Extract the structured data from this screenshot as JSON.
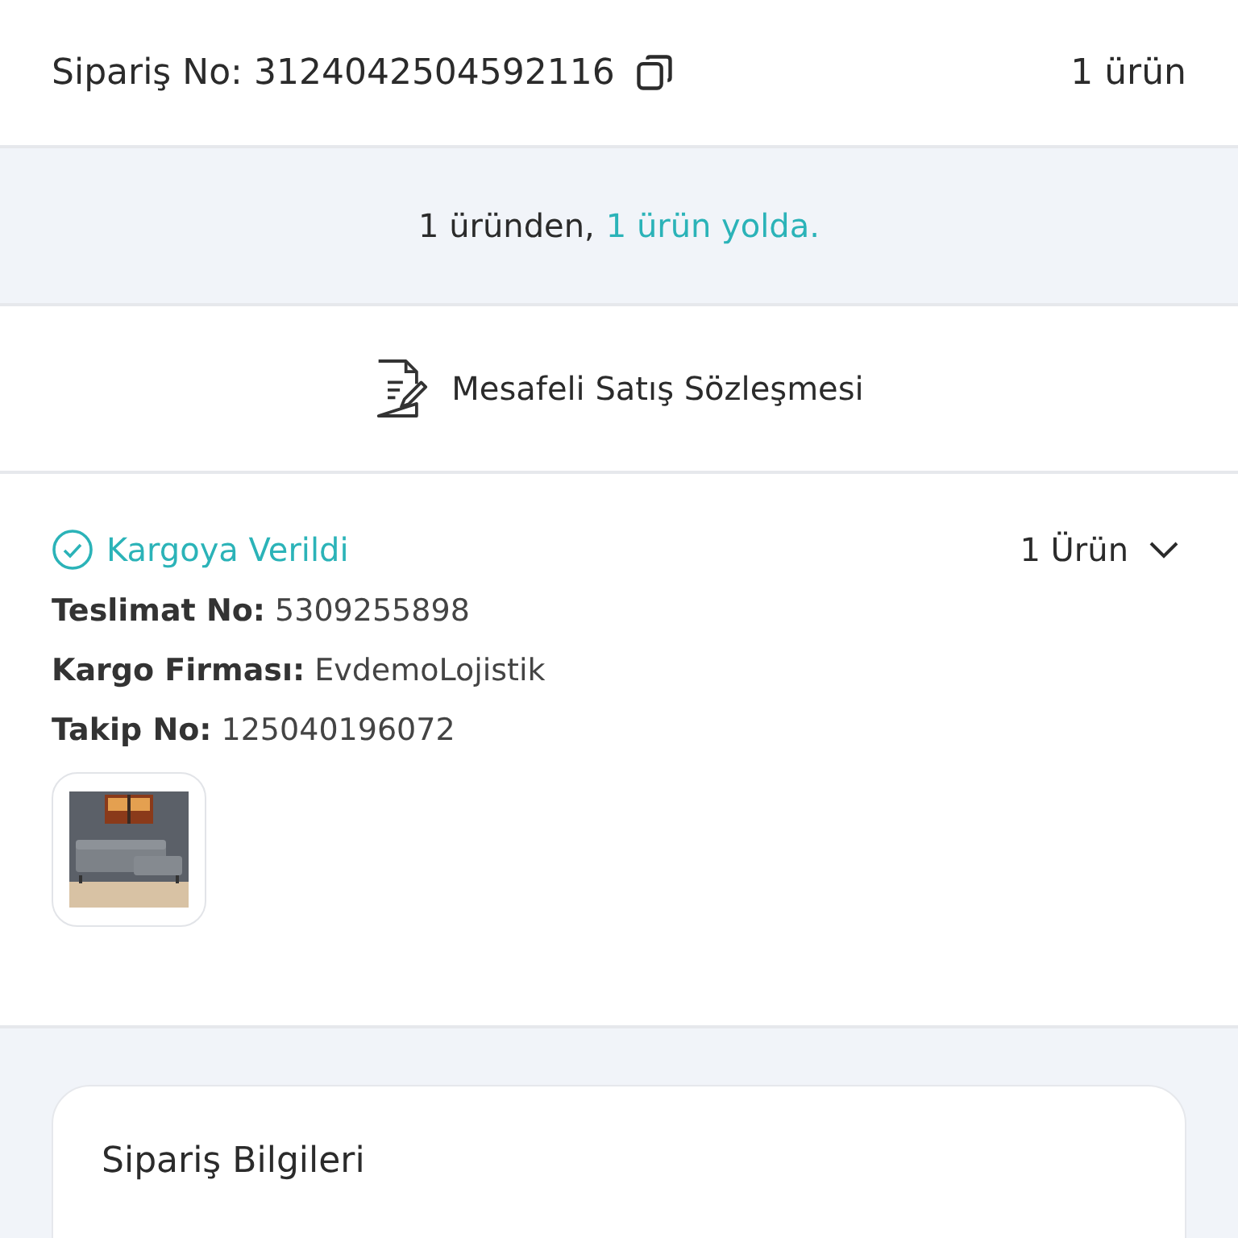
{
  "header": {
    "order_label": "Sipariş No: 3124042504592116",
    "item_count": "1 ürün"
  },
  "summary": {
    "total_text": "1 üründen,",
    "status_text": "1 ürün yolda."
  },
  "contract_link": "Mesafeli Satış Sözleşmesi",
  "shipment": {
    "status": "Kargoya Verildi",
    "items_toggle": "1 Ürün",
    "expanded": false,
    "details": [
      {
        "label": "Teslimat No:",
        "value": "5309255898"
      },
      {
        "label": "Kargo Firması:",
        "value": "EvdemoLojistik"
      },
      {
        "label": "Takip No:",
        "value": "125040196072"
      }
    ]
  },
  "order_info": {
    "title": "Sipariş Bilgileri"
  }
}
